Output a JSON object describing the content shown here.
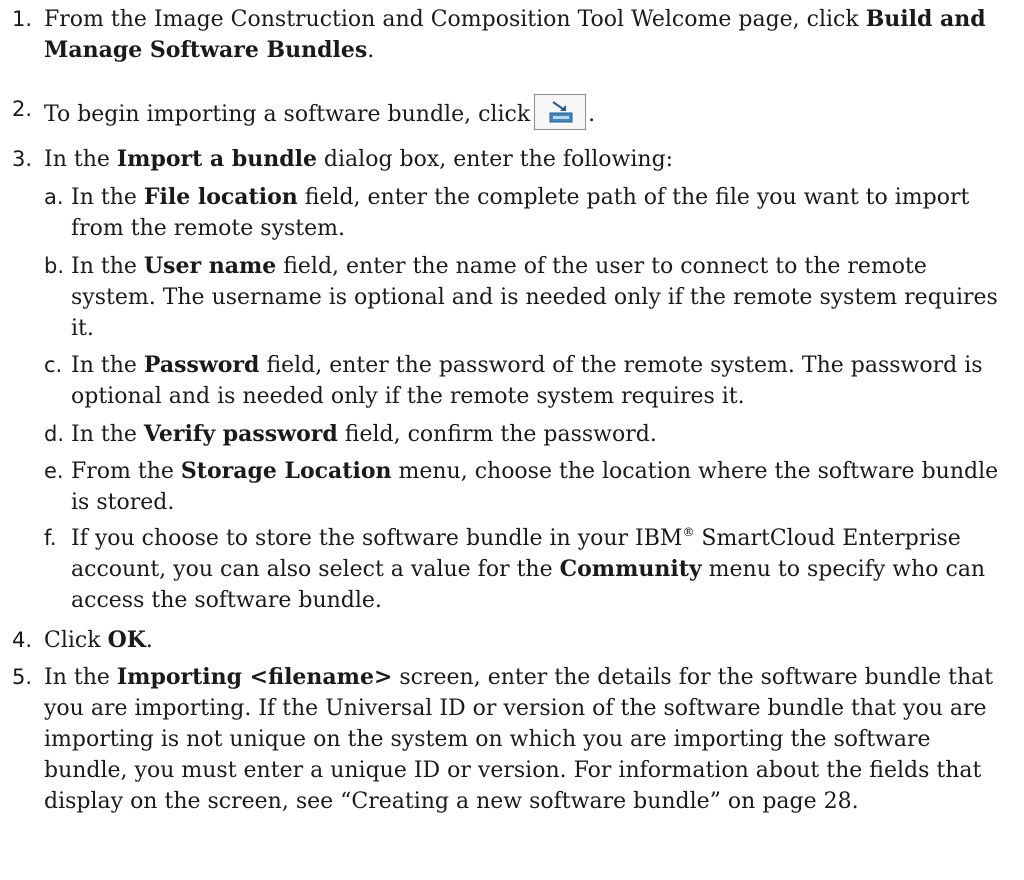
{
  "steps": [
    {
      "num": "1.",
      "pre": "From the Image Construction and Composition Tool Welcome page, click ",
      "bold": "Build and Manage Software Bundles",
      "post": "."
    },
    {
      "num": "2.",
      "pre": "To begin importing a software bundle, click",
      "icon": "import-bundle-icon",
      "post": "."
    },
    {
      "num": "3.",
      "pre": "In the ",
      "bold": "Import a bundle",
      "post": " dialog box, enter the following:"
    },
    {
      "num": "4.",
      "pre": "Click ",
      "bold": "OK",
      "post": "."
    },
    {
      "num": "5.",
      "pre": "In the ",
      "bold": "Importing <filename>",
      "post": " screen, enter the details for the software bundle that you are importing. If the Universal ID or version of the software bundle that you are importing is not unique on the system on which you are importing the software bundle, you must enter a unique ID or version. For information about the fields that display on the screen, see “Creating a new software bundle” on page 28."
    }
  ],
  "substeps": [
    {
      "letter": "a.",
      "pre": "In the ",
      "bold": "File location",
      "post": " field, enter the complete path of the file you want to import from the remote system."
    },
    {
      "letter": "b.",
      "pre": "In the ",
      "bold": "User name",
      "post": " field, enter the name of the user to connect to the remote system. The username is optional and is needed only if the remote system requires it."
    },
    {
      "letter": "c.",
      "pre": "In the ",
      "bold": "Password",
      "post": " field, enter the password of the remote system. The password is optional and is needed only if the remote system requires it."
    },
    {
      "letter": "d.",
      "pre": "In the ",
      "bold": "Verify password",
      "post": " field, confirm the password."
    },
    {
      "letter": "e.",
      "pre": "From the ",
      "bold": "Storage Location",
      "post": " menu, choose the location where the software bundle is stored."
    },
    {
      "letter": "f.",
      "pre": "If you choose to store the software bundle in your IBM",
      "sup": "®",
      "mid": " SmartCloud Enterprise account, you can also select a value for the ",
      "bold": "Community",
      "post": " menu to specify who can access the software bundle."
    }
  ]
}
